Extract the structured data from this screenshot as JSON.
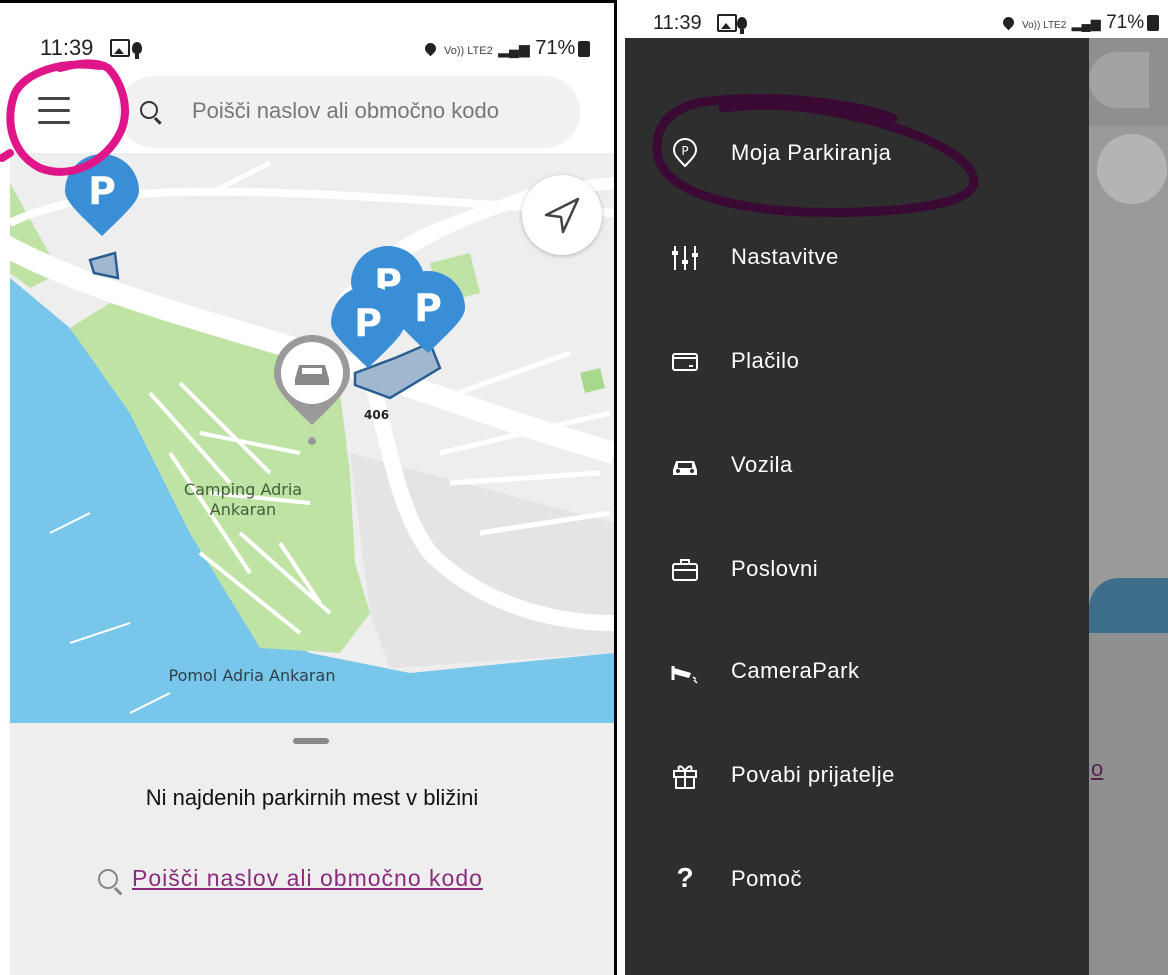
{
  "left_screen": {
    "status_bar": {
      "time": "11:39",
      "network": "Vo)) LTE2",
      "battery": "71%"
    },
    "search": {
      "placeholder": "Poišči naslov ali območno kodo"
    },
    "map": {
      "labels": [
        "Camping Adria Ankaran",
        "Pomol Adria Ankaran",
        "406"
      ],
      "camping_line1": "Camping Adria",
      "camping_line2": "Ankaran",
      "pier": "Pomol Adria Ankaran",
      "road_number": "406",
      "parking_letter": "P"
    },
    "bottom_sheet": {
      "message": "Ni najdenih parkirnih mest v bližini",
      "link": "Poišči naslov ali območno kodo"
    }
  },
  "right_screen": {
    "status_bar": {
      "time": "11:39",
      "network": "Vo)) LTE2",
      "battery": "71%"
    },
    "menu": [
      {
        "label": "Moja Parkiranja",
        "icon": "parking-pin-icon"
      },
      {
        "label": "Nastavitve",
        "icon": "sliders-icon"
      },
      {
        "label": "Plačilo",
        "icon": "card-icon"
      },
      {
        "label": "Vozila",
        "icon": "car-icon"
      },
      {
        "label": "Poslovni",
        "icon": "briefcase-icon"
      },
      {
        "label": "CameraPark",
        "icon": "camera-icon"
      },
      {
        "label": "Povabi prijatelje",
        "icon": "gift-icon"
      },
      {
        "label": "Pomoč",
        "icon": "help-icon"
      }
    ],
    "help_glyph": "?",
    "background_link_fragment": "o"
  },
  "colors": {
    "annotation_magenta": "#e0158a",
    "annotation_dark_purple": "#3a0a34",
    "parking_blue": "#3a8ed6",
    "map_green": "#bfe3a5",
    "water": "#78c7ea",
    "link_purple": "#8a2b7e",
    "drawer_bg": "#2e2e2e"
  }
}
